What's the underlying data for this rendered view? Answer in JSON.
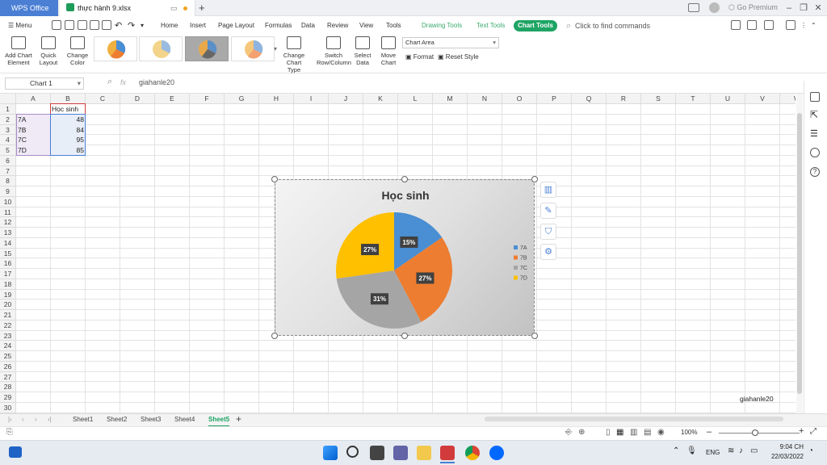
{
  "titlebar": {
    "app_tab": "WPS Office",
    "file_tab": "thực hành 9.xlsx",
    "new_tab": "+",
    "premium": "Go Premium"
  },
  "menu": {
    "menu_label": "Menu",
    "items": [
      "Home",
      "Insert",
      "Page Layout",
      "Formulas",
      "Data",
      "Review",
      "View",
      "Tools"
    ],
    "green_items": [
      "Drawing Tools",
      "Text Tools"
    ],
    "active_tab": "Chart Tools",
    "search_placeholder": "Click to find commands"
  },
  "ribbon": {
    "add_chart_element": "Add Chart Element",
    "quick_layout": "Quick Layout",
    "change_color": "Change Color",
    "change_chart_type": "Change Chart Type",
    "switch_row_column": "Switch Row/Column",
    "select_data": "Select Data",
    "move_chart": "Move Chart",
    "chart_area_dropdown": "Chart Area",
    "format": "Format",
    "reset_style": "Reset Style"
  },
  "formula_bar": {
    "name_box": "Chart 1",
    "fx": "fx",
    "formula": "giahanle20"
  },
  "grid": {
    "columns": [
      "A",
      "B",
      "C",
      "D",
      "E",
      "F",
      "G",
      "H",
      "I",
      "J",
      "K",
      "L",
      "M",
      "N",
      "O",
      "P",
      "Q",
      "R",
      "S",
      "T",
      "U",
      "V",
      "W"
    ],
    "rows": [
      "1",
      "2",
      "3",
      "4",
      "5",
      "6",
      "7",
      "8",
      "9",
      "10",
      "11",
      "12",
      "13",
      "14",
      "15",
      "16",
      "17",
      "18",
      "19",
      "20",
      "21",
      "22",
      "23",
      "24",
      "25",
      "26",
      "27",
      "28",
      "29",
      "30"
    ],
    "header_b1": "Học sinh",
    "data_rows": [
      {
        "label": "7A",
        "value": "48"
      },
      {
        "label": "7B",
        "value": "84"
      },
      {
        "label": "7C",
        "value": "95"
      },
      {
        "label": "7D",
        "value": "85"
      }
    ],
    "v29": "giahanle20"
  },
  "chart_data": {
    "type": "pie",
    "title": "Học sinh",
    "categories": [
      "7A",
      "7B",
      "7C",
      "7D"
    ],
    "values": [
      48,
      84,
      95,
      85
    ],
    "data_labels": [
      "15%",
      "27%",
      "31%",
      "27%"
    ],
    "colors": [
      "#4a8ed3",
      "#ed7d31",
      "#a5a5a5",
      "#ffc000"
    ],
    "legend": "right"
  },
  "sheets": {
    "tabs": [
      "Sheet1",
      "Sheet2",
      "Sheet3",
      "Sheet4",
      "Sheet5"
    ],
    "active": "Sheet5"
  },
  "status": {
    "zoom": "100%"
  },
  "taskbar": {
    "lang": "ENG",
    "time": "9:04 CH",
    "date": "22/03/2022"
  },
  "colors": {
    "accent_blue": "#4a7fd4",
    "accent_green": "#1ea464"
  }
}
